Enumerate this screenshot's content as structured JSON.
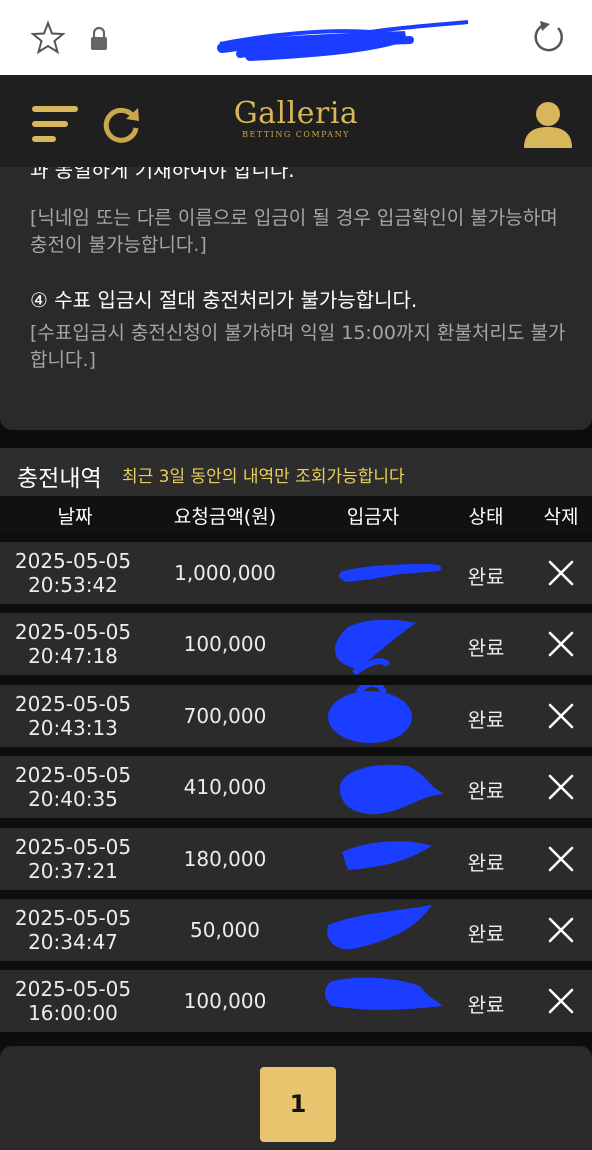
{
  "browser": {
    "url_redacted": true
  },
  "header": {
    "logo_text": "Galleria",
    "logo_subtext": "BETTING COMPANY"
  },
  "notice": {
    "clipped_line": "과 동일하게 기재하여야 합니다.",
    "note_1": "[닉네임 또는 다른 이름으로 입금이 될 경우 입금확인이 불가능하며 충전이 불가능합니다.]",
    "item_4": "④ 수표 입금시 절대 충전처리가 불가능합니다.",
    "note_4": "[수표입금시 충전신청이 불가하며 익일 15:00까지 환불처리도 불가합니다.]"
  },
  "history": {
    "title": "충전내역",
    "subtitle": "최근 3일 동안의 내역만 조회가능합니다",
    "columns": {
      "date": "날짜",
      "amount": "요청금액(원)",
      "depositor": "입금자",
      "status": "상태",
      "delete": "삭제"
    },
    "rows": [
      {
        "date": "2025-05-05",
        "time": "20:53:42",
        "amount": "1,000,000",
        "status": "완료"
      },
      {
        "date": "2025-05-05",
        "time": "20:47:18",
        "amount": "100,000",
        "status": "완료"
      },
      {
        "date": "2025-05-05",
        "time": "20:43:13",
        "amount": "700,000",
        "status": "완료"
      },
      {
        "date": "2025-05-05",
        "time": "20:40:35",
        "amount": "410,000",
        "status": "완료"
      },
      {
        "date": "2025-05-05",
        "time": "20:37:21",
        "amount": "180,000",
        "status": "완료"
      },
      {
        "date": "2025-05-05",
        "time": "20:34:47",
        "amount": "50,000",
        "status": "완료"
      },
      {
        "date": "2025-05-05",
        "time": "16:00:00",
        "amount": "100,000",
        "status": "완료"
      }
    ]
  },
  "pagination": {
    "current": "1"
  },
  "colors": {
    "accent_gold": "#e9c46e",
    "logo_gold": "#d8b65a",
    "redaction_blue": "#1a3dff",
    "subtitle_yellow": "#e6cf5e"
  }
}
